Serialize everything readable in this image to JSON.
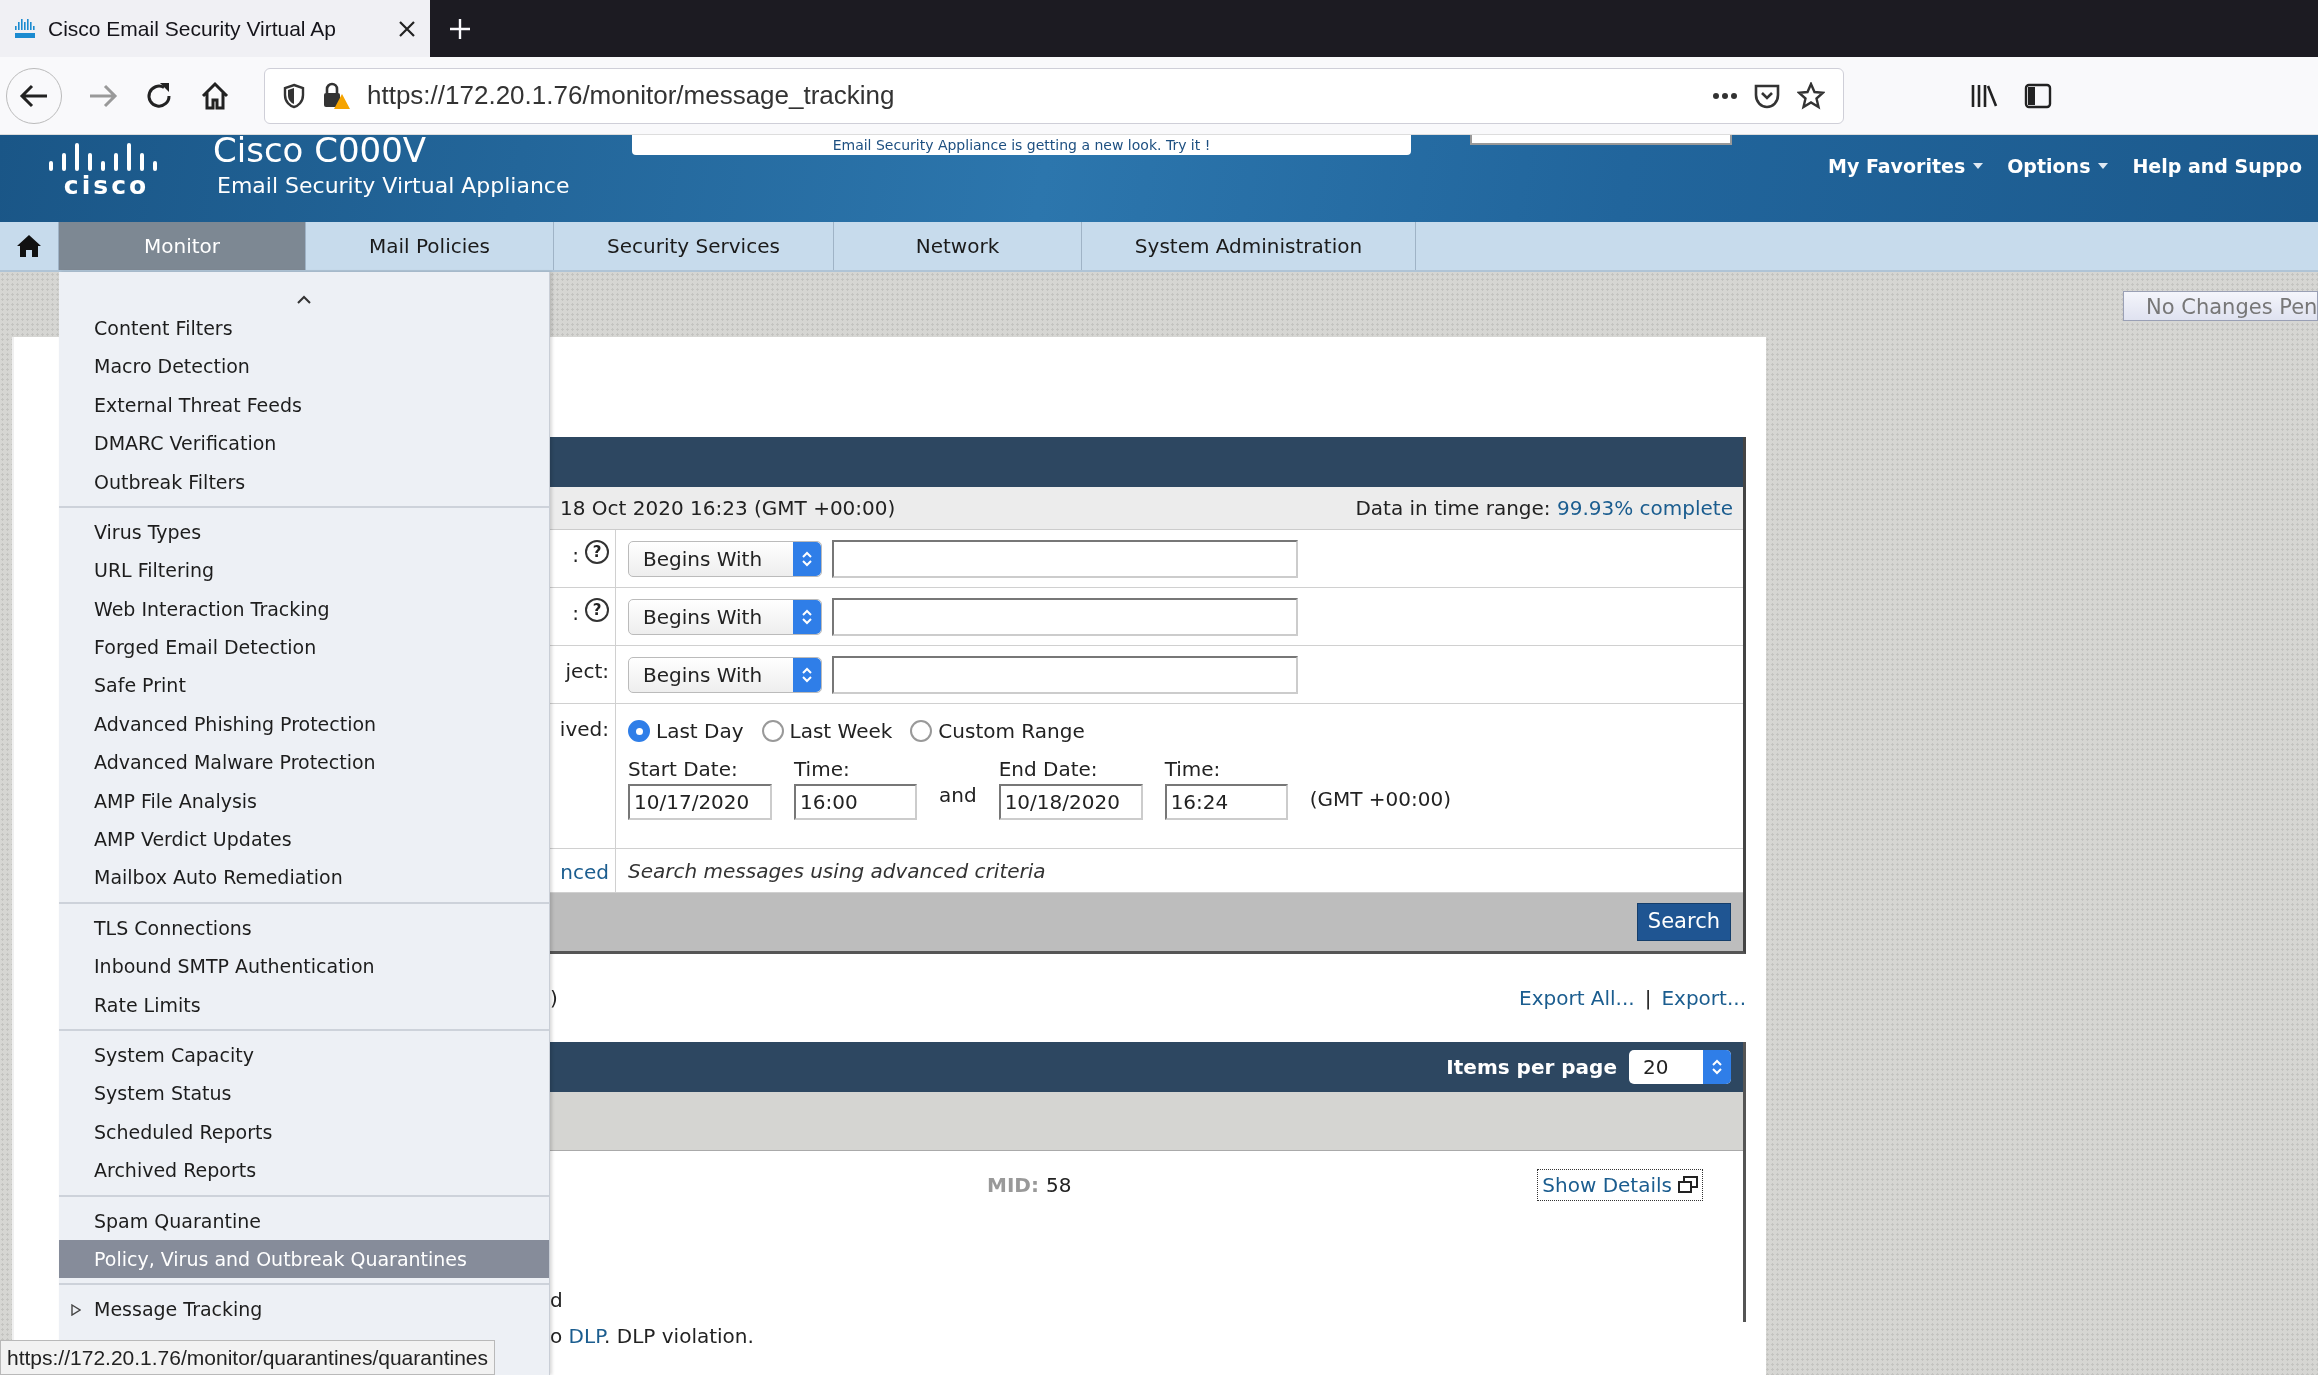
{
  "browser": {
    "tab_title": "Cisco Email Security Virtual Ap",
    "url": "https://172.20.1.76/monitor/message_tracking",
    "status_url": "https://172.20.1.76/monitor/quarantines/quarantines"
  },
  "header": {
    "logo_text": "cisco",
    "product": "Cisco C000V",
    "subtitle": "Email Security Virtual Appliance",
    "banner": "Email Security Appliance is getting a new look. Try it !",
    "links": [
      {
        "label": "My Favorites",
        "caret": true
      },
      {
        "label": "Options",
        "caret": true
      },
      {
        "label": "Help and Suppo",
        "caret": false
      }
    ]
  },
  "nav": [
    {
      "label": "Monitor",
      "selected": true
    },
    {
      "label": "Mail Policies",
      "selected": false
    },
    {
      "label": "Security Services",
      "selected": false
    },
    {
      "label": "Network",
      "selected": false
    },
    {
      "label": "System Administration",
      "selected": false
    }
  ],
  "menu": {
    "groups": [
      [
        {
          "label": "Content Filters",
          "selected": false
        },
        {
          "label": "Macro Detection",
          "selected": false
        },
        {
          "label": "External Threat Feeds",
          "selected": false
        },
        {
          "label": "DMARC Verification",
          "selected": false
        },
        {
          "label": "Outbreak Filters",
          "selected": false
        }
      ],
      [
        {
          "label": "Virus Types",
          "selected": false
        },
        {
          "label": "URL Filtering",
          "selected": false
        },
        {
          "label": "Web Interaction Tracking",
          "selected": false
        },
        {
          "label": "Forged Email Detection",
          "selected": false
        },
        {
          "label": "Safe Print",
          "selected": false
        },
        {
          "label": "Advanced Phishing Protection",
          "selected": false
        },
        {
          "label": "Advanced Malware Protection",
          "selected": false
        },
        {
          "label": "AMP File Analysis",
          "selected": false
        },
        {
          "label": "AMP Verdict Updates",
          "selected": false
        },
        {
          "label": "Mailbox Auto Remediation",
          "selected": false
        }
      ],
      [
        {
          "label": "TLS Connections",
          "selected": false
        },
        {
          "label": "Inbound SMTP Authentication",
          "selected": false
        },
        {
          "label": "Rate Limits",
          "selected": false
        }
      ],
      [
        {
          "label": "System Capacity",
          "selected": false
        },
        {
          "label": "System Status",
          "selected": false
        },
        {
          "label": "Scheduled Reports",
          "selected": false
        },
        {
          "label": "Archived Reports",
          "selected": false
        }
      ],
      [
        {
          "label": "Spam Quarantine",
          "selected": false
        },
        {
          "label": "Policy, Virus and Outbreak Quarantines",
          "selected": true
        }
      ]
    ],
    "tracking": {
      "label": "Message Tracking",
      "expanded": false
    }
  },
  "pending_button": "No Changes Pen",
  "search_form": {
    "range_text": "18 Oct 2020 16:23 (GMT +00:00)",
    "range_label": "Data in time range:",
    "range_value": "99.93% complete",
    "fields": [
      {
        "label": ":",
        "help": "?",
        "operator": "Begins With"
      },
      {
        "label": ":",
        "help": "?",
        "operator": "Begins With"
      },
      {
        "label": "ject:",
        "operator": "Begins With"
      }
    ],
    "received": {
      "label": "ived:",
      "options": [
        {
          "label": "Last Day",
          "selected": true
        },
        {
          "label": "Last Week",
          "selected": false
        },
        {
          "label": "Custom Range",
          "selected": false
        }
      ],
      "start_date_label": "Start Date:",
      "start_date": "10/17/2020",
      "start_time_label": "Time:",
      "start_time": "16:00",
      "and": "and",
      "end_date_label": "End Date:",
      "end_date": "10/18/2020",
      "end_time_label": "Time:",
      "end_time": "16:24",
      "timezone": "(GMT +00:00)"
    },
    "advanced": {
      "link": "nced",
      "text": "Search messages using advanced criteria"
    },
    "search_button": "Search"
  },
  "results": {
    "summary": ")",
    "export_links": [
      "Export All...",
      "Export..."
    ],
    "separator": "|",
    "items_per_page_label": "Items per page",
    "items_per_page": "20",
    "mid_label": "MID:",
    "mid": "58",
    "show_details": "Show Details",
    "line_1": "d",
    "line_2": {
      "before": "o ",
      "link": "DLP",
      "after": ". DLP violation."
    }
  }
}
